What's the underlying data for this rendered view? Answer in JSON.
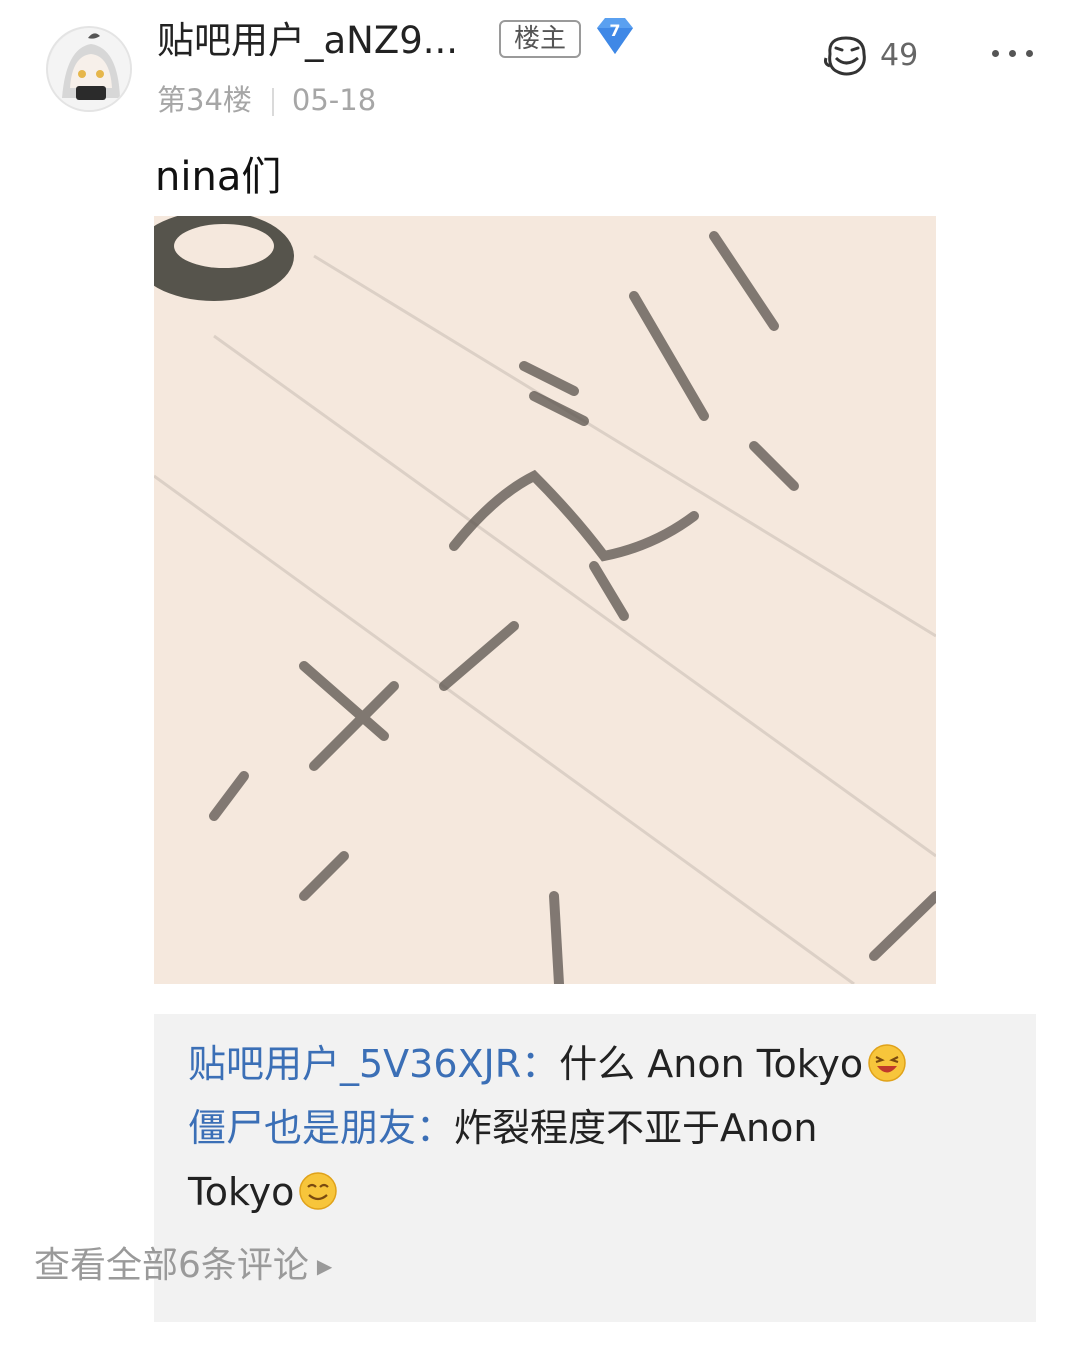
{
  "post": {
    "username": "贴吧用户_aNZ9...",
    "op_badge": "楼主",
    "level": "7",
    "floor": "第34楼",
    "date": "05-18",
    "likes": "49",
    "text": "nina们"
  },
  "comments": [
    {
      "author": "贴吧用户_5V36XJR：",
      "text": "什么 Anon Tokyo",
      "emoji": "laughing-emoji"
    },
    {
      "author": "僵尸也是朋友：",
      "text": "炸裂程度不亚于Anon",
      "text_cont": "Tokyo",
      "emoji": "smile-emoji"
    }
  ],
  "view_all": "查看全部6条评论",
  "icons": {
    "like": "emoji-face-icon",
    "more": "more-dots-icon",
    "level": "diamond-level-icon"
  },
  "colors": {
    "link": "#3b6fb6",
    "level_badge": "#5aa0f0",
    "comment_bg": "#f2f2f2"
  }
}
